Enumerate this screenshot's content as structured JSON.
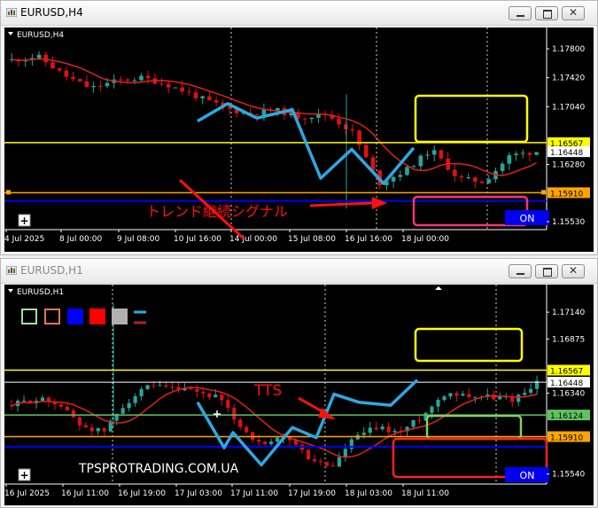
{
  "window1": {
    "title": "EURUSD,H4",
    "chart_label": "EURUSD,H4",
    "prices": [
      "1.17800",
      "1.17420",
      "1.17040",
      "1.16567",
      "1.16448",
      "1.16280",
      "1.15910",
      "1.15530"
    ],
    "times": [
      "4 Jul 2025",
      "8 Jul 00:00",
      "9 Jul 08:00",
      "10 Jul 16:00",
      "14 Jul 00:00",
      "15 Jul 08:00",
      "16 Jul 16:00",
      "18 Jul 00:00"
    ],
    "annotation": "トレンド継続シグナル",
    "on_label": "ON"
  },
  "window2": {
    "title": "EURUSD,H1",
    "chart_label": "EURUSD,H1",
    "prices": [
      "1.17140",
      "1.16875",
      "1.16567",
      "1.16448",
      "1.16340",
      "1.16124",
      "1.15910",
      "1.15540"
    ],
    "times": [
      "16 Jul 2025",
      "16 Jul 11:00",
      "16 Jul 19:00",
      "17 Jul 03:00",
      "17 Jul 11:00",
      "17 Jul 19:00",
      "18 Jul 03:00",
      "18 Jul 11:00"
    ],
    "annotation": "TTS",
    "watermark": "TPSPROTRADING.COM.UA",
    "on_label": "ON"
  },
  "colors": {
    "yellow_line": "#ffff00",
    "orange_line": "#ffa500",
    "blue_line": "#0000ff",
    "green_line": "#5ec45e",
    "bull": "#26a69a",
    "bear": "#e01010",
    "zigzag": "#2ea8e0",
    "ma": "#e02020",
    "box_yellow": "#ffff00",
    "box_pink": "#ff3377",
    "box_red": "#ff2020",
    "box_green": "#7fd45a"
  }
}
